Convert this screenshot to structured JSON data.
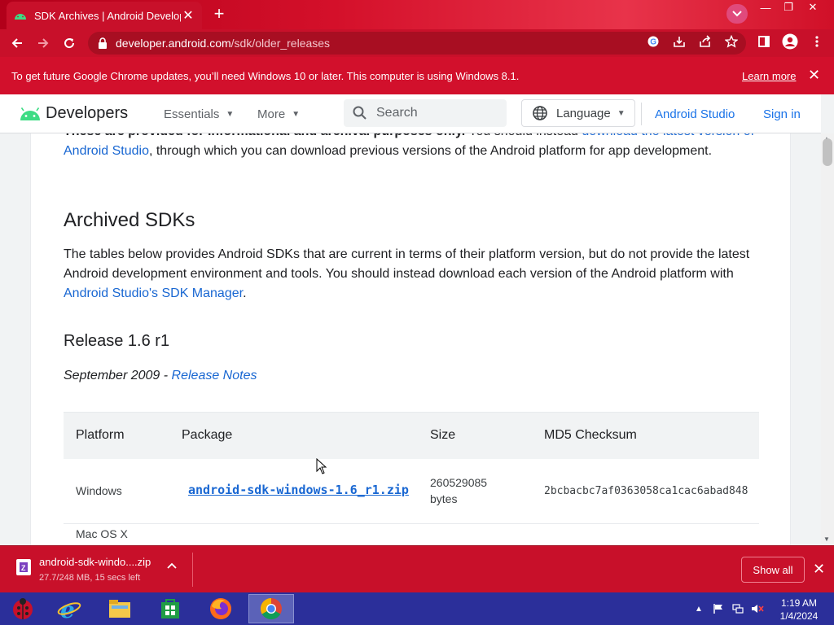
{
  "browser": {
    "tab_title": "SDK Archives  |  Android Develop",
    "url_host": "developer.android.com",
    "url_path": "/sdk/older_releases",
    "infobar_text": "To get future Google Chrome updates, you’ll need Windows 10 or later. This computer is using Windows 8.1.",
    "infobar_link": "Learn more"
  },
  "site_header": {
    "brand": "Developers",
    "nav": [
      "Essentials",
      "More"
    ],
    "search_placeholder": "Search",
    "language": "Language",
    "android_studio": "Android Studio",
    "sign_in": "Sign in"
  },
  "content": {
    "intro_bold": "These are provided for informational and archival purposes only.",
    "intro_rest": " You should instead ",
    "intro_link": "download the latest version of Android Studio",
    "intro_tail": ", through which you can download previous versions of the Android platform for app development.",
    "h_archived": "Archived SDKs",
    "archived_text": "The tables below provides Android SDKs that are current in terms of their platform version, but do not provide the latest Android development environment and tools. You should instead download each version of the Android platform with ",
    "archived_link": "Android Studio's SDK Manager",
    "archived_tail": ".",
    "release_title": "Release 1.6 r1",
    "release_date": "September 2009 - ",
    "release_notes": "Release Notes",
    "table": {
      "headers": [
        "Platform",
        "Package",
        "Size",
        "MD5 Checksum"
      ],
      "rows": [
        {
          "platform": "Windows",
          "package": "android-sdk-windows-1.6_r1.zip",
          "size_line1": "260529085",
          "size_line2": "bytes",
          "md5": "2bcbacbc7af0363058ca1cac6abad848"
        }
      ],
      "partial_row_text": "Mac OS X"
    }
  },
  "download_shelf": {
    "file_name": "android-sdk-windo....zip",
    "status": "27.7/248 MB, 15 secs left",
    "show_all": "Show all"
  },
  "taskbar": {
    "time": "1:19 AM",
    "date": "1/4/2024"
  },
  "colors": {
    "chrome_red": "#c8102a",
    "link_blue": "#1967d2",
    "android_green": "#3ddc84",
    "taskbar_blue": "#2b2f9a"
  }
}
